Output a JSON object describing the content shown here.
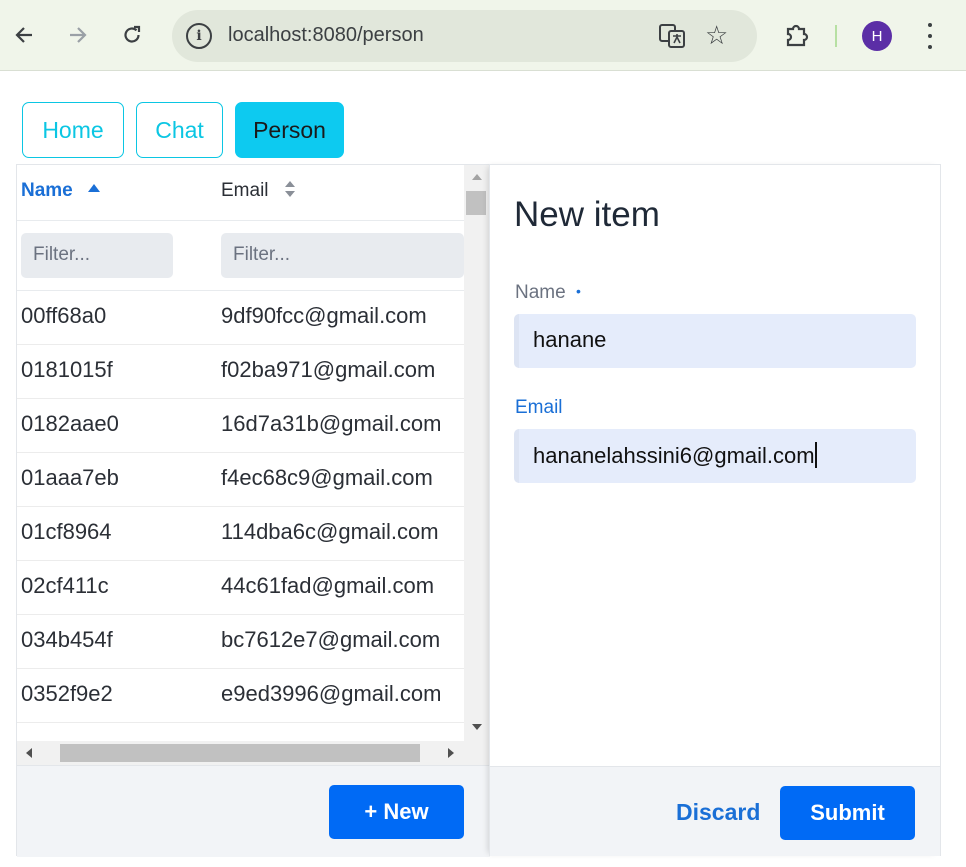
{
  "browser": {
    "url": "localhost:8080/person",
    "profile_initial": "H",
    "info_glyph": "i"
  },
  "tabs": [
    {
      "label": "Home",
      "active": false
    },
    {
      "label": "Chat",
      "active": false
    },
    {
      "label": "Person",
      "active": true
    }
  ],
  "grid": {
    "columns": [
      {
        "label": "Name",
        "sort": "ascending"
      },
      {
        "label": "Email",
        "sort": "none"
      }
    ],
    "filters": [
      {
        "placeholder": "Filter..."
      },
      {
        "placeholder": "Filter..."
      }
    ],
    "rows": [
      {
        "name": "00ff68a0",
        "email": "9df90fcc@gmail.com"
      },
      {
        "name": "0181015f",
        "email": "f02ba971@gmail.com"
      },
      {
        "name": "0182aae0",
        "email": "16d7a31b@gmail.com"
      },
      {
        "name": "01aaa7eb",
        "email": "f4ec68c9@gmail.com"
      },
      {
        "name": "01cf8964",
        "email": "114dba6c@gmail.com"
      },
      {
        "name": "02cf411c",
        "email": "44c61fad@gmail.com"
      },
      {
        "name": "034b454f",
        "email": "bc7612e7@gmail.com"
      },
      {
        "name": "0352f9e2",
        "email": "e9ed3996@gmail.com"
      }
    ],
    "new_button": "+ New"
  },
  "form": {
    "title": "New item",
    "name_label": "Name",
    "required_marker": "•",
    "name_value": "hanane",
    "email_label": "Email",
    "email_value": "hananelahssini6@gmail.com",
    "discard_label": "Discard",
    "submit_label": "Submit"
  },
  "colors": {
    "accent": "#0dcaf0",
    "primary_button": "#006af5",
    "link": "#1a6fd6"
  }
}
